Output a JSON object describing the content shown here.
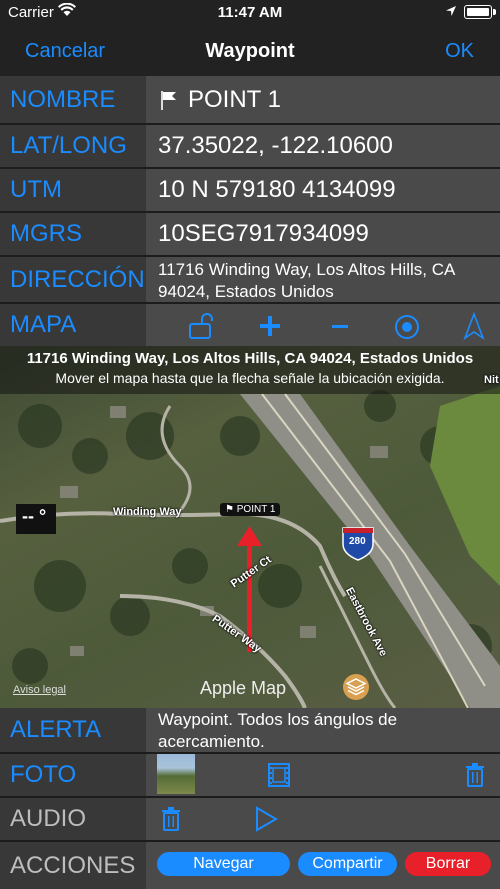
{
  "status": {
    "carrier": "Carrier",
    "time": "11:47 AM"
  },
  "nav": {
    "cancel": "Cancelar",
    "title": "Waypoint",
    "ok": "OK"
  },
  "fields": {
    "nombre": {
      "label": "NOMBRE",
      "value": "POINT 1"
    },
    "latlong": {
      "label": "LAT/LONG",
      "value": "37.35022, -122.10600"
    },
    "utm": {
      "label": "UTM",
      "value": "10 N 579180 4134099"
    },
    "mgrs": {
      "label": "MGRS",
      "value": "10SEG7917934099"
    },
    "direccion": {
      "label": "DIRECCIÓN",
      "line1": "11716 Winding Way, Los Altos Hills, CA",
      "line2": "94024, Estados Unidos"
    },
    "mapa": {
      "label": "MAPA"
    },
    "alerta": {
      "label": "ALERTA",
      "line1": "Waypoint.  Todos los ángulos de",
      "line2": "acercamiento."
    },
    "foto": {
      "label": "FOTO"
    },
    "audio": {
      "label": "AUDIO"
    },
    "acciones": {
      "label": "ACCIONES"
    }
  },
  "map": {
    "address": "11716 Winding Way, Los Altos Hills, CA  94024, Estados Unidos",
    "instruction": "Mover el mapa hasta que la flecha señale la ubicación exigida.",
    "coord": "-- °",
    "pin_label": "POINT 1",
    "roads": [
      "Winding Way",
      "Putter Ct",
      "Putter Way",
      "Eastbrook Ave",
      "280",
      "Nit"
    ],
    "legal": "Aviso legal",
    "brand": "Apple Map"
  },
  "actions": {
    "navigate": "Navegar",
    "share": "Compartir",
    "delete": "Borrar"
  },
  "colors": {
    "accent": "#1a8cff",
    "delete": "#e8202a",
    "arrow": "#e8202a"
  }
}
